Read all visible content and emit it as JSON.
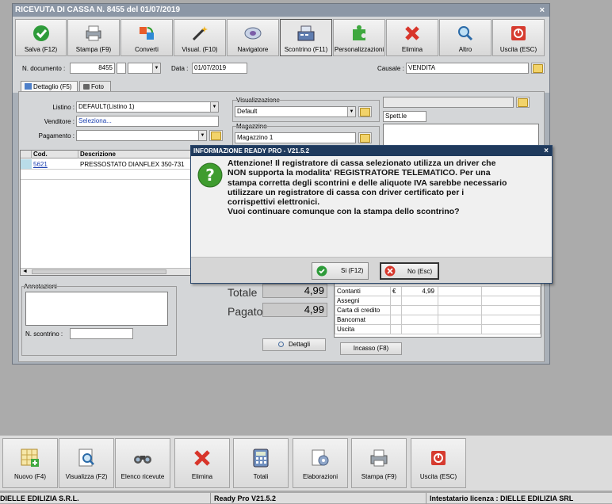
{
  "window": {
    "title": "RICEVUTA DI CASSA N. 8455 del 01/07/2019",
    "toolbar": [
      {
        "label": "Salva (F12)",
        "icon": "check-icon"
      },
      {
        "label": "Stampa (F9)",
        "icon": "printer-icon"
      },
      {
        "label": "Converti",
        "icon": "convert-icon"
      },
      {
        "label": "Visual. (F10)",
        "icon": "wand-icon"
      },
      {
        "label": "Navigatore",
        "icon": "navigator-icon"
      },
      {
        "label": "Scontrino (F11)",
        "icon": "cash-register-icon"
      },
      {
        "label": "Personalizzazioni",
        "icon": "puzzle-icon"
      },
      {
        "label": "Elimina",
        "icon": "delete-x-icon"
      },
      {
        "label": "Altro",
        "icon": "magnifier-icon"
      },
      {
        "label": "Uscita (ESC)",
        "icon": "exit-icon"
      }
    ]
  },
  "form": {
    "doc_label": "N. documento :",
    "doc_value": "8455",
    "data_label": "Data :",
    "data_value": "01/07/2019",
    "causale_label": "Causale :",
    "causale_value": "VENDITA"
  },
  "tabs": [
    {
      "label": "Dettaglio (F5)"
    },
    {
      "label": "Foto"
    }
  ],
  "dettaglio": {
    "listino_label": "Listino :",
    "listino_value": "DEFAULT(Listino 1)",
    "venditore_label": "Venditore :",
    "venditore_value": "Seleziona...",
    "pagamento_label": "Pagamento :",
    "visualizzazione_label": "Visualizzazione",
    "visualizzazione_value": "Default",
    "magazzino_label": "Magazzino",
    "magazzino_value": "Magazzino 1",
    "spett_label": "Spett.le"
  },
  "grid": {
    "headers": [
      "Cod.",
      "Descrizione"
    ],
    "rows": [
      {
        "cod": "5621",
        "desc": "PRESSOSTATO DIANFLEX 350-731"
      }
    ]
  },
  "annotazioni_label": "Annotazioni",
  "scontrino_label": "N. scontrino :",
  "totals": {
    "totale_label": "Totale",
    "totale_value": "4,99",
    "pagato_label": "Pagato",
    "pagato_value": "4,99",
    "dettagli_label": "Dettagli"
  },
  "payments": {
    "rows": [
      {
        "label": "Contanti",
        "currency": "€",
        "amount": "4,99"
      },
      {
        "label": "Assegni",
        "currency": "",
        "amount": ""
      },
      {
        "label": "Carta di credito",
        "currency": "",
        "amount": ""
      },
      {
        "label": "Bancomat",
        "currency": "",
        "amount": ""
      },
      {
        "label": "Uscita",
        "currency": "",
        "amount": ""
      }
    ],
    "incasso_label": "Incasso (F8)"
  },
  "dialog": {
    "title": "INFORMAZIONE READY PRO - V21.5.2",
    "message_lines": [
      "Attenzione! Il registratore di cassa selezionato utilizza un driver che",
      "NON supporta la modalita' REGISTRATORE TELEMATICO. Per una",
      "stampa corretta degli scontrini e delle aliquote IVA sarebbe necessario",
      "utilizzare un registratore di cassa con driver certificato per i",
      "corrispettivi elettronici.",
      "Vuoi continuare comunque con la stampa dello scontrino?"
    ],
    "yes_label": "Si (F12)",
    "no_label": "No (Esc)"
  },
  "bottom_toolbar": [
    {
      "label": "Nuovo (F4)",
      "icon": "new-grid-icon"
    },
    {
      "label": "Visualizza (F2)",
      "icon": "view-doc-icon"
    },
    {
      "label": "Elenco ricevute",
      "icon": "binoculars-icon"
    },
    {
      "label": "Elimina",
      "icon": "delete-x-icon"
    },
    {
      "label": "Totali",
      "icon": "calculator-icon"
    },
    {
      "label": "Elaborazioni",
      "icon": "process-icon"
    },
    {
      "label": "Stampa (F9)",
      "icon": "printer-icon"
    },
    {
      "label": "Uscita (ESC)",
      "icon": "exit-icon"
    }
  ],
  "statusbar": {
    "company": "DIELLE EDILIZIA S.R.L.",
    "version": "Ready Pro V21.5.2",
    "license": "Intestatario licenza : DIELLE EDILIZIA SRL"
  },
  "colors": {
    "dialog_title_bg": "#1f3a5d",
    "window_title_bg": "#8c97a6",
    "exit_red": "#d63b2f",
    "ok_green": "#3aa23a"
  }
}
